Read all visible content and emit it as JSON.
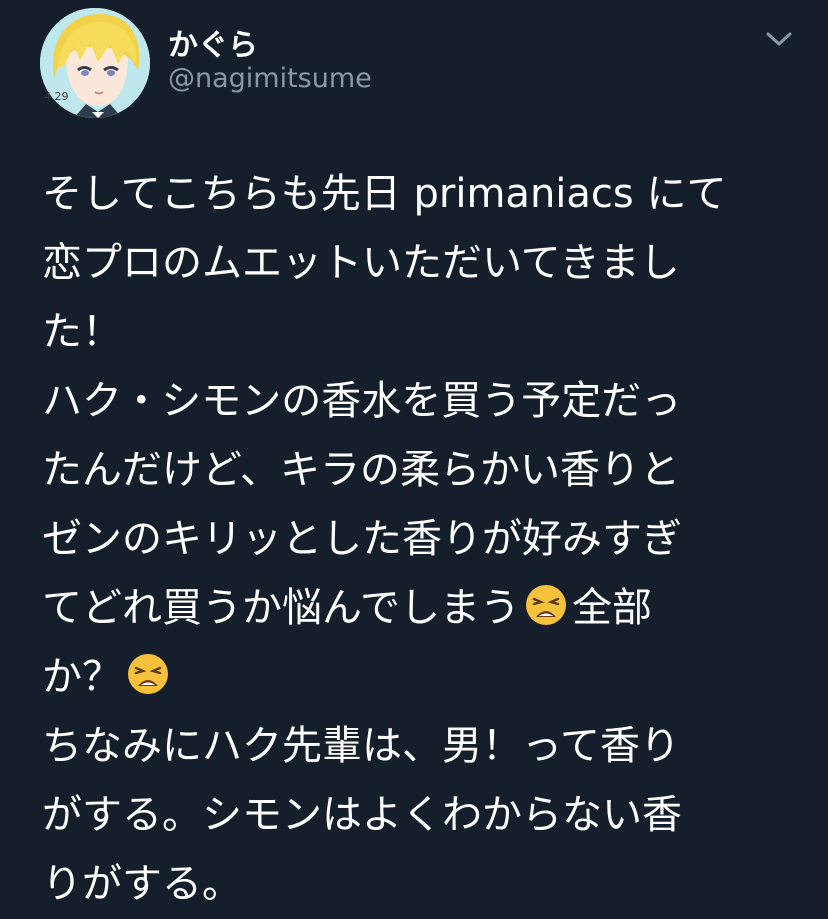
{
  "tweet": {
    "display_name": "かぐら",
    "handle": "@nagimitsume",
    "avatar_note": "4.29",
    "more_icon": "chevron-down-icon",
    "lines": [
      {
        "a": "そしてこちらも先日 primaniacs にて",
        "b": ""
      },
      {
        "a": "恋プロのムエットいただいてきまし",
        "b": ""
      },
      {
        "a": "た！",
        "b": ""
      },
      {
        "a": "ハク・シモンの香水を買う予定だっ",
        "b": ""
      },
      {
        "a": "たんだけど、キラの柔らかい香りと",
        "b": ""
      },
      {
        "a": "ゼンのキリッとした香りが好みすぎ",
        "b": ""
      },
      {
        "a": "てどれ買うか悩んでしまう",
        "b": "全部"
      },
      {
        "a": "か？",
        "b": ""
      },
      {
        "a": "ちなみにハク先輩は、男！って香り",
        "b": ""
      },
      {
        "a": "がする。シモンはよくわからない香",
        "b": ""
      },
      {
        "a": "りがする。",
        "b": ""
      }
    ],
    "emoji_name": "weary-face-icon"
  },
  "colors": {
    "background": "#151f2b",
    "text": "#ffffff",
    "secondary_text": "#8899a6"
  }
}
